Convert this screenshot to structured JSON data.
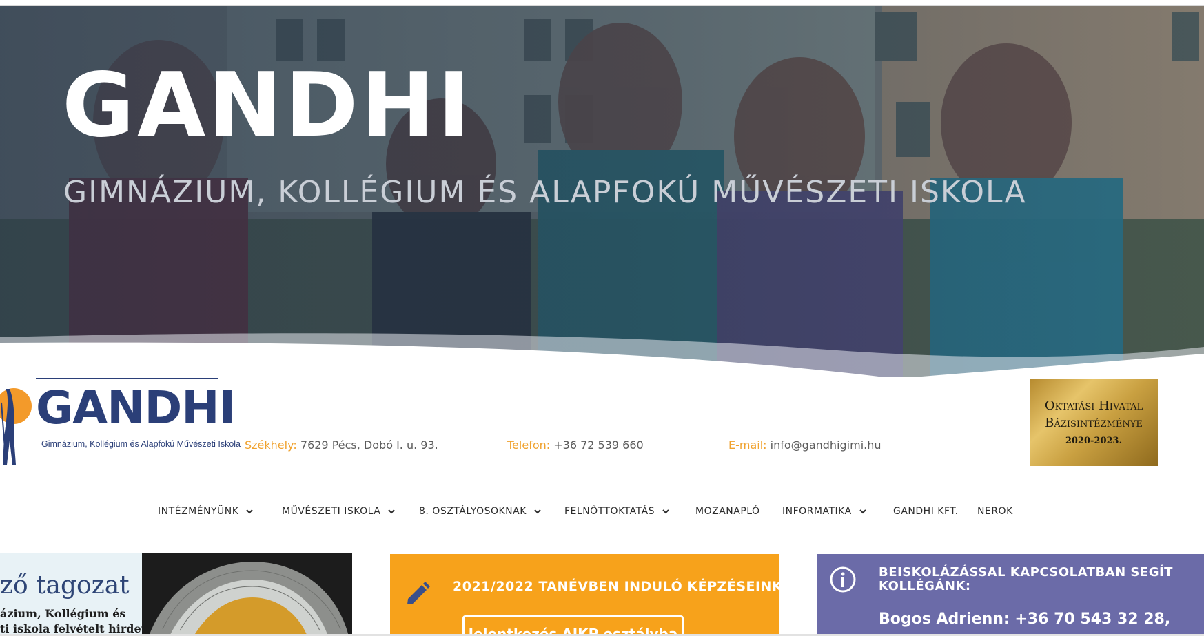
{
  "hero": {
    "title": "GANDHI",
    "subtitle": "GIMNÁZIUM, KOLLÉGIUM ÉS ALAPFOKÚ MŰVÉSZETI ISKOLA"
  },
  "logo": {
    "text": "GANDHI",
    "subtitle": "Gimnázium, Kollégium és Alapfokú Művészeti Iskola"
  },
  "contact": {
    "address_label": "Székhely:",
    "address": "7629 Pécs, Dobó I. u. 93.",
    "phone_label": "Telefon:",
    "phone": "+36 72 539 660",
    "email_label": "E-mail:",
    "email": "info@gandhigimi.hu"
  },
  "badge": {
    "line1": "Oktatási Hivatal",
    "line2": "Bázisintézménye",
    "line3": "2020-2023."
  },
  "nav": {
    "items": [
      {
        "label": "INTÉZMÉNYÜNK",
        "dropdown": true
      },
      {
        "label": "MŰVÉSZETI ISKOLA",
        "dropdown": true
      },
      {
        "label": "8. OSZTÁLYOSOKNAK",
        "dropdown": true
      },
      {
        "label": "FELNŐTTOKTATÁS",
        "dropdown": true
      },
      {
        "label": "MOZANAPLÓ",
        "dropdown": false
      },
      {
        "label": "INFORMATIKA",
        "dropdown": true
      },
      {
        "label": "GANDHI KFT.",
        "dropdown": false
      },
      {
        "label": "NEROK",
        "dropdown": false
      }
    ]
  },
  "cards": {
    "image_card": {
      "tag": "ző tagozat",
      "line1": "ázium, Kollégium és",
      "line2": "ti iskola felvételt hirdet"
    },
    "orange_card": {
      "title": "2021/2022 TANÉVBEN INDULÓ KÉPZÉSEINK",
      "button": "Jelentkezés AJKP osztályba"
    },
    "purple_card": {
      "title": "BEISKOLÁZÁSSAL KAPCSOLATBAN SEGÍT KOLLÉGÁNK:",
      "contact": "Bogos Adrienn: +36 70 543 32 28,"
    }
  },
  "colors": {
    "accent_orange": "#f7a21b",
    "label_orange": "#f0a22e",
    "brand_blue": "#2b3f78",
    "purple": "#6b6ba8"
  }
}
